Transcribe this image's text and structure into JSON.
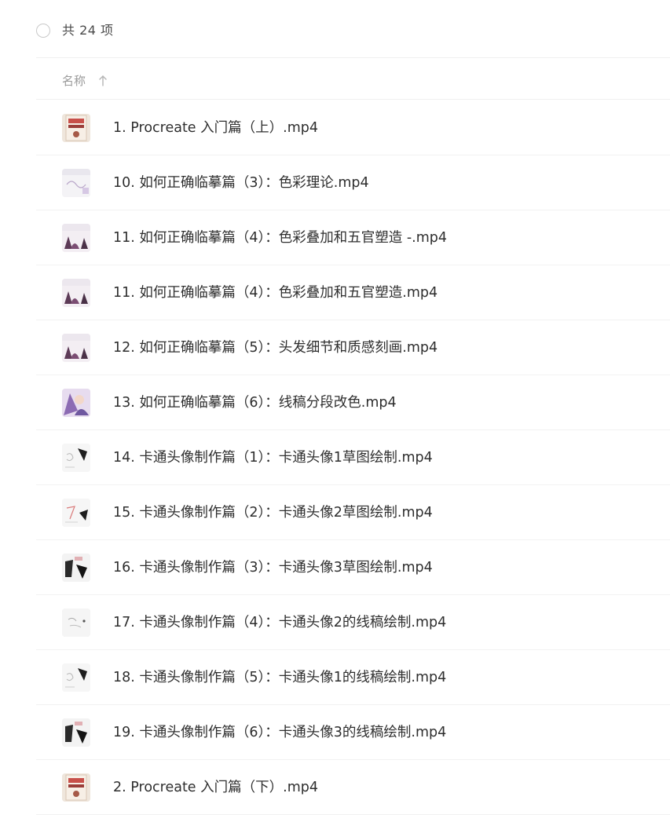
{
  "header": {
    "count_label": "共 24 项"
  },
  "columns": {
    "name_label": "名称",
    "sort_icon": "arrow-up-icon"
  },
  "files": [
    {
      "name": "1. Procreate 入门篇（上）.mp4",
      "thumb": "book-cover"
    },
    {
      "name": "10. 如何正确临摹篇（3）：色彩理论.mp4",
      "thumb": "sketch-pale"
    },
    {
      "name": "11. 如何正确临摹篇（4）：色彩叠加和五官塑造 -.mp4",
      "thumb": "portrait-purple"
    },
    {
      "name": "11. 如何正确临摹篇（4）：色彩叠加和五官塑造.mp4",
      "thumb": "portrait-purple"
    },
    {
      "name": "12. 如何正确临摹篇（5）：头发细节和质感刻画.mp4",
      "thumb": "portrait-purple"
    },
    {
      "name": "13. 如何正确临摹篇（6）：线稿分段改色.mp4",
      "thumb": "character-purple"
    },
    {
      "name": "14. 卡通头像制作篇（1）：卡通头像1草图绘制.mp4",
      "thumb": "cartoon-sketch"
    },
    {
      "name": "15. 卡通头像制作篇（2）：卡通头像2草图绘制.mp4",
      "thumb": "cartoon-sketch-red"
    },
    {
      "name": "16. 卡通头像制作篇（3）：卡通头像3草图绘制.mp4",
      "thumb": "cartoon-dark"
    },
    {
      "name": "17. 卡通头像制作篇（4）：卡通头像2的线稿绘制.mp4",
      "thumb": "cartoon-lines"
    },
    {
      "name": "18. 卡通头像制作篇（5）：卡通头像1的线稿绘制.mp4",
      "thumb": "cartoon-sketch"
    },
    {
      "name": "19. 卡通头像制作篇（6）：卡通头像3的线稿绘制.mp4",
      "thumb": "cartoon-dark"
    },
    {
      "name": "2. Procreate 入门篇（下）.mp4",
      "thumb": "book-cover"
    }
  ]
}
